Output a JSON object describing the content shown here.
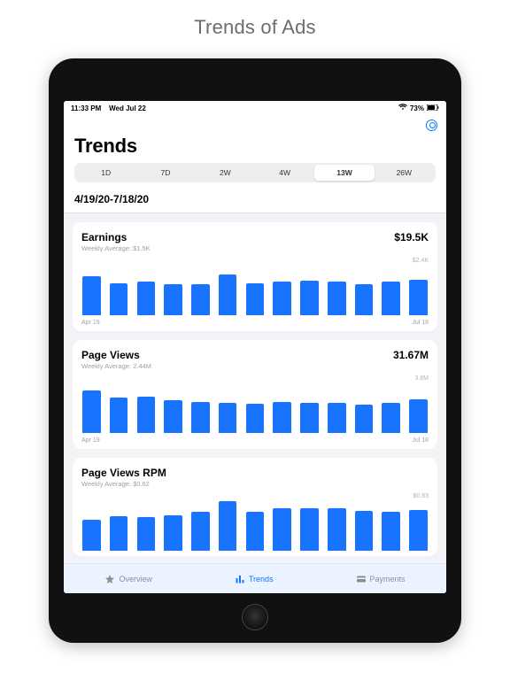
{
  "page_heading": "Trends of Ads",
  "status": {
    "time": "11:33 PM",
    "date": "Wed Jul 22",
    "battery": "73%"
  },
  "header": {
    "title": "Trends"
  },
  "segments": {
    "items": [
      "1D",
      "7D",
      "2W",
      "4W",
      "13W",
      "26W"
    ],
    "selected": 4
  },
  "date_range": "4/19/20-7/18/20",
  "cards": [
    {
      "title": "Earnings",
      "subtitle": "Weekly Average: $1.5K",
      "value": "$19.5K",
      "y_max": "$2.4K",
      "x_start": "Apr 19",
      "x_end": "Jul 18",
      "bars": [
        78,
        65,
        68,
        63,
        62,
        82,
        64,
        68,
        69,
        67,
        63,
        67,
        71
      ]
    },
    {
      "title": "Page Views",
      "subtitle": "Weekly Average: 2.44M",
      "value": "31.67M",
      "y_max": "3.8M",
      "x_start": "Apr 19",
      "x_end": "Jul 18",
      "bars": [
        86,
        71,
        73,
        66,
        62,
        60,
        59,
        62,
        60,
        60,
        57,
        60,
        67
      ]
    },
    {
      "title": "Page Views RPM",
      "subtitle": "Weekly Average: $0.62",
      "value": "",
      "y_max": "$0.83",
      "x_start": "Apr 19",
      "x_end": "Jul 18",
      "bars": [
        63,
        69,
        68,
        72,
        78,
        100,
        79,
        85,
        85,
        86,
        80,
        79,
        82
      ]
    }
  ],
  "tabs": {
    "items": [
      {
        "label": "Overview",
        "icon": "star"
      },
      {
        "label": "Trends",
        "icon": "bars"
      },
      {
        "label": "Payments",
        "icon": "card"
      }
    ],
    "active": 1
  },
  "chart_data": [
    {
      "type": "bar",
      "title": "Earnings",
      "ylabel": "",
      "ylim": [
        0,
        2400
      ],
      "categories_span": [
        "Apr 19",
        "Jul 18"
      ],
      "series": [
        {
          "name": "weekly",
          "values": [
            1870,
            1560,
            1630,
            1510,
            1490,
            1970,
            1540,
            1630,
            1660,
            1610,
            1510,
            1610,
            1700
          ]
        }
      ]
    },
    {
      "type": "bar",
      "title": "Page Views",
      "ylabel": "",
      "ylim": [
        0,
        3800000
      ],
      "categories_span": [
        "Apr 19",
        "Jul 18"
      ],
      "series": [
        {
          "name": "weekly",
          "values": [
            3270000,
            2700000,
            2770000,
            2510000,
            2360000,
            2280000,
            2240000,
            2360000,
            2280000,
            2280000,
            2170000,
            2280000,
            2550000
          ]
        }
      ]
    },
    {
      "type": "bar",
      "title": "Page Views RPM",
      "ylabel": "",
      "ylim": [
        0,
        0.83
      ],
      "categories_span": [
        "Apr 19",
        "Jul 18"
      ],
      "series": [
        {
          "name": "weekly",
          "values": [
            0.52,
            0.57,
            0.56,
            0.6,
            0.65,
            0.83,
            0.66,
            0.71,
            0.71,
            0.71,
            0.66,
            0.66,
            0.68
          ]
        }
      ]
    }
  ]
}
